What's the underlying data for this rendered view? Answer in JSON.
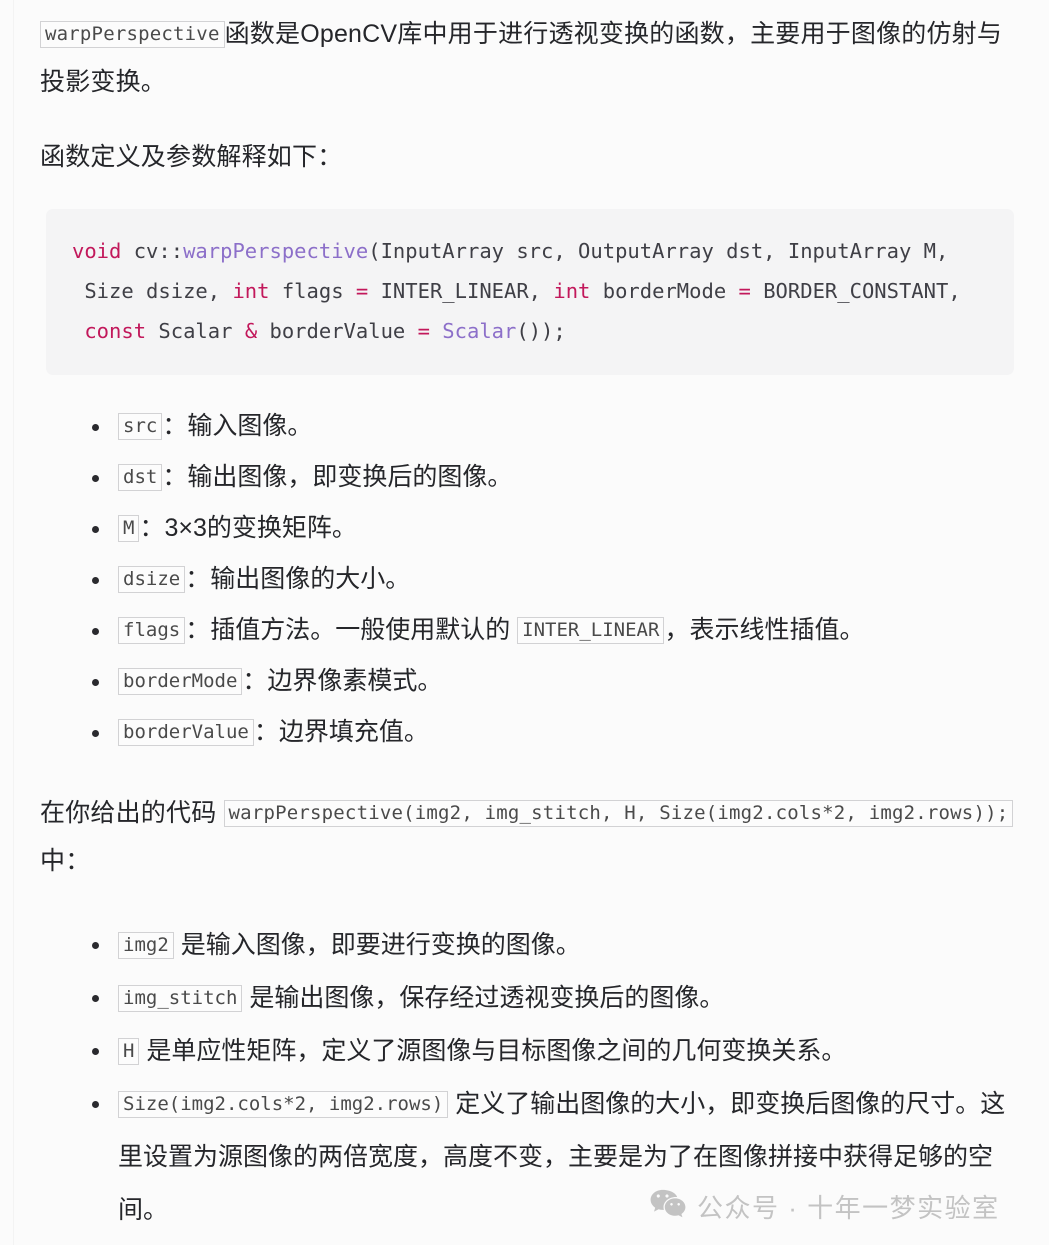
{
  "document": {
    "intro_paragraph": {
      "code_chip": "warpPerspective",
      "text": "函数是OpenCV库中用于进行透视变换的函数，主要用于图像的仿射与投影变换。"
    },
    "definition_lead": "函数定义及参数解释如下：",
    "code_block": {
      "language": "cpp",
      "tokens": [
        {
          "t": "void",
          "k": "kw"
        },
        {
          "t": " cv::",
          "k": "plain"
        },
        {
          "t": "warpPerspective",
          "k": "fn"
        },
        {
          "t": "(InputArray src, OutputArray dst, InputArray M,\n Size dsize, ",
          "k": "plain"
        },
        {
          "t": "int",
          "k": "kw"
        },
        {
          "t": " flags ",
          "k": "plain"
        },
        {
          "t": "=",
          "k": "op"
        },
        {
          "t": " INTER_LINEAR, ",
          "k": "plain"
        },
        {
          "t": "int",
          "k": "kw"
        },
        {
          "t": " borderMode ",
          "k": "plain"
        },
        {
          "t": "=",
          "k": "op"
        },
        {
          "t": " BORDER_CONSTANT,\n ",
          "k": "plain"
        },
        {
          "t": "const",
          "k": "kw"
        },
        {
          "t": " Scalar ",
          "k": "plain"
        },
        {
          "t": "&",
          "k": "op"
        },
        {
          "t": " borderValue ",
          "k": "plain"
        },
        {
          "t": "=",
          "k": "op"
        },
        {
          "t": " ",
          "k": "plain"
        },
        {
          "t": "Scalar",
          "k": "fn"
        },
        {
          "t": "());",
          "k": "plain"
        }
      ],
      "plain_text": "void cv::warpPerspective(InputArray src, OutputArray dst, InputArray M,\n Size dsize, int flags = INTER_LINEAR, int borderMode = BORDER_CONSTANT,\n const Scalar & borderValue = Scalar());"
    },
    "param_list": [
      {
        "chip": "src",
        "text": "：输入图像。"
      },
      {
        "chip": "dst",
        "text": "：输出图像，即变换后的图像。"
      },
      {
        "chip": "M",
        "text": "：3×3的变换矩阵。"
      },
      {
        "chip": "dsize",
        "text": "：输出图像的大小。"
      },
      {
        "chip": "flags",
        "text": "：插值方法。一般使用默认的 ",
        "chip2": "INTER_LINEAR",
        "text2": "，表示线性插值。"
      },
      {
        "chip": "borderMode",
        "text": "：边界像素模式。"
      },
      {
        "chip": "borderValue",
        "text": "：边界填充值。"
      }
    ],
    "usage_paragraph": {
      "prefix": "在你给出的代码 ",
      "code_chip": "warpPerspective(img2, img_stitch, H, Size(img2.cols*2, img2.rows));",
      "suffix": " 中："
    },
    "usage_list": [
      {
        "chip": "img2",
        "text": " 是输入图像，即要进行变换的图像。"
      },
      {
        "chip": "img_stitch",
        "text": " 是输出图像，保存经过透视变换后的图像。"
      },
      {
        "chip": "H",
        "text": " 是单应性矩阵，定义了源图像与目标图像之间的几何变换关系。"
      },
      {
        "chip": "Size(img2.cols*2, img2.rows)",
        "text": " 定义了输出图像的大小，即变换后图像的尺寸。这里设置为源图像的两倍宽度，高度不变，主要是为了在图像拼接中获得足够的空间。"
      }
    ],
    "watermark": {
      "icon": "wechat-icon",
      "text": "公众号 · 十年一梦实验室",
      "color": "#c3c3c3"
    },
    "colors": {
      "page_background": "#fbfbfb",
      "code_block_background": "#f4f4f5",
      "body_text": "#25262a",
      "keyword": "#c2185b",
      "function": "#8c6fc9",
      "inline_code_border": "#d2d2d4",
      "inline_code_text": "#4a4a4a"
    }
  }
}
